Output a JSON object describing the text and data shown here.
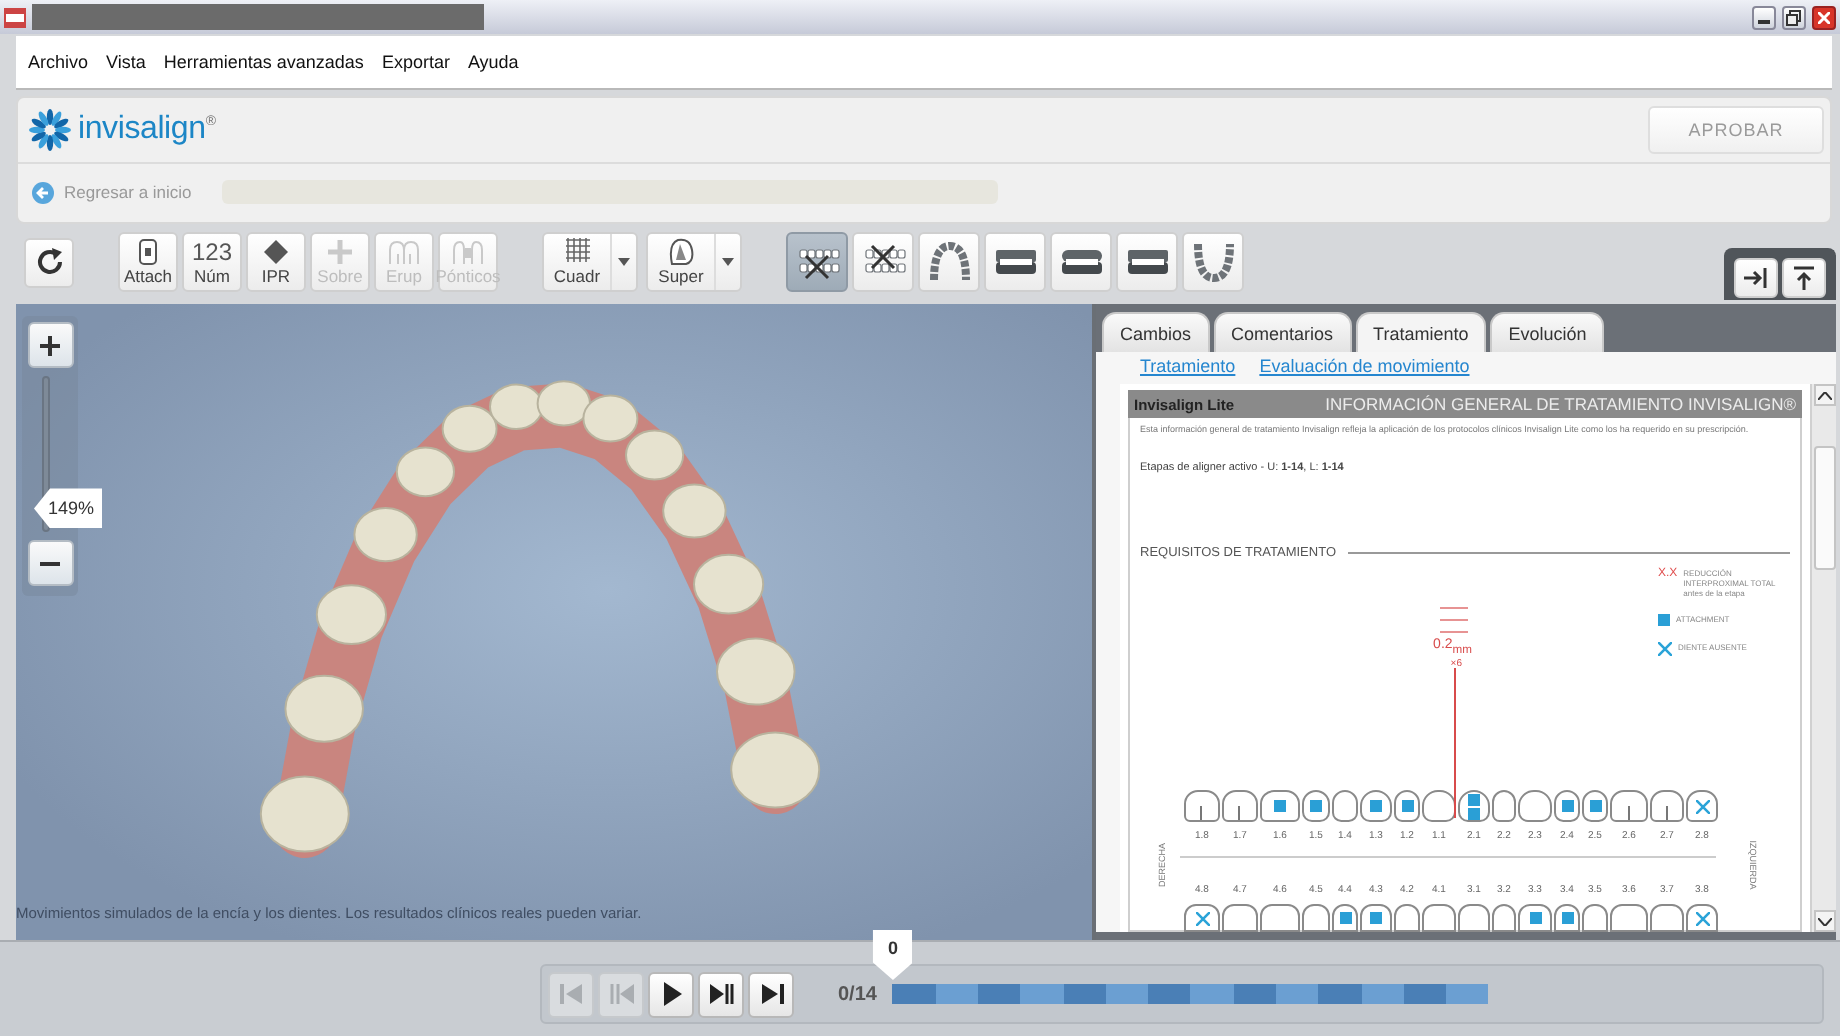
{
  "menu": [
    {
      "label": "Archivo"
    },
    {
      "label": "Vista"
    },
    {
      "label": "Herramientas avanzadas"
    },
    {
      "label": "Exportar"
    },
    {
      "label": "Ayuda"
    }
  ],
  "header": {
    "logo": "invisalign$^{®}$",
    "approve_button": "APROBAR",
    "back_link": "Regresar a inicio"
  },
  "toolbar": {
    "tools": [
      {
        "kind": "attach",
        "label": "Attach",
        "disabled": false
      },
      {
        "kind": "number",
        "glyph": "123",
        "label": "Núm",
        "disabled": false
      },
      {
        "kind": "ipr",
        "label": "IPR",
        "disabled": false
      },
      {
        "kind": "plus",
        "label": "Sobre",
        "disabled": true
      },
      {
        "kind": "erup",
        "label": "Erup",
        "disabled": true
      },
      {
        "kind": "pontic",
        "label": "Pónticos",
        "disabled": true
      }
    ],
    "dropdowns": [
      {
        "kind": "grid",
        "label": "Cuadr"
      },
      {
        "kind": "superimpose",
        "label": "Super"
      }
    ],
    "views": [
      {
        "kind": "hide-upper",
        "selected": true
      },
      {
        "kind": "hide-lower",
        "selected": false
      },
      {
        "kind": "upper-occlusal",
        "selected": false
      },
      {
        "kind": "right",
        "selected": false
      },
      {
        "kind": "front",
        "selected": false
      },
      {
        "kind": "left",
        "selected": false
      },
      {
        "kind": "lower-occlusal",
        "selected": false
      }
    ]
  },
  "viewer": {
    "zoom": {
      "reading": "149%",
      "level": 0.15
    },
    "caption": "Movimientos simulados de la encía y los dientes. Los resultados clínicos reales pueden variar."
  },
  "panel": {
    "tabs": [
      {
        "label": "Cambios",
        "selected": false
      },
      {
        "label": "Comentarios",
        "selected": false
      },
      {
        "label": "Tratamiento",
        "selected": true
      },
      {
        "label": "Evolución",
        "selected": false
      }
    ],
    "links": [
      {
        "label": "Tratamiento"
      },
      {
        "label": "Evaluación de movimiento"
      }
    ],
    "document": {
      "product": "Invisalign Lite",
      "heading": "INFORMACIÓN GENERAL DE TRATAMIENTO INVISALIGN®",
      "intro": "Esta información general de tratamiento Invisalign refleja la aplicación de los protocolos clínicos Invisalign Lite como los ha requerido en su prescripción.",
      "stages": "Etapas de aligner activo - U: **1-14**, L: **1-14**",
      "section": "REQUISITOS DE TRATAMIENTO",
      "legend": [
        {
          "kind": "ipr",
          "symbol": "X.X",
          "label": "REDUCCIÓN INTERPROXIMAL TOTAL antes de la etapa"
        },
        {
          "kind": "attachment",
          "label": "ATTACHMENT"
        },
        {
          "kind": "missing",
          "label": "DIENTE AUSENTE"
        }
      ],
      "ipr": {
        "amount": "0.2$_{mm}$",
        "stage": "×6"
      },
      "side_labels": [
        "DERECHA",
        "IZQUIERDA"
      ],
      "upper_teeth": [
        {
          "number": "1.8",
          "kind": "plain",
          "ipr": false
        },
        {
          "number": "1.7",
          "kind": "plain",
          "ipr": false
        },
        {
          "number": "1.6",
          "kind": "attachment",
          "ipr": false
        },
        {
          "number": "1.5",
          "kind": "attachment",
          "ipr": false
        },
        {
          "number": "1.4",
          "kind": "plain",
          "ipr": false
        },
        {
          "number": "1.3",
          "kind": "attachment",
          "ipr": false
        },
        {
          "number": "1.2",
          "kind": "attachment",
          "ipr": false
        },
        {
          "number": "1.1",
          "kind": "plain",
          "ipr": true
        },
        {
          "number": "2.1",
          "kind": "double-attachment",
          "ipr": false
        },
        {
          "number": "2.2",
          "kind": "plain",
          "ipr": false
        },
        {
          "number": "2.3",
          "kind": "plain",
          "ipr": false
        },
        {
          "number": "2.4",
          "kind": "attachment",
          "ipr": false
        },
        {
          "number": "2.5",
          "kind": "attachment",
          "ipr": false
        },
        {
          "number": "2.6",
          "kind": "plain",
          "ipr": false
        },
        {
          "number": "2.7",
          "kind": "plain",
          "ipr": false
        },
        {
          "number": "2.8",
          "kind": "missing",
          "ipr": false
        }
      ],
      "lower_teeth": [
        {
          "number": "4.8",
          "kind": "missing"
        },
        {
          "number": "4.7",
          "kind": "plain"
        },
        {
          "number": "4.6",
          "kind": "plain"
        },
        {
          "number": "4.5",
          "kind": "plain"
        },
        {
          "number": "4.4",
          "kind": "attachment"
        },
        {
          "number": "4.3",
          "kind": "attachment"
        },
        {
          "number": "4.2",
          "kind": "plain"
        },
        {
          "number": "4.1",
          "kind": "plain"
        },
        {
          "number": "3.1",
          "kind": "plain"
        },
        {
          "number": "3.2",
          "kind": "plain"
        },
        {
          "number": "3.3",
          "kind": "attachment"
        },
        {
          "number": "3.4",
          "kind": "attachment"
        },
        {
          "number": "3.5",
          "kind": "plain"
        },
        {
          "number": "3.6",
          "kind": "plain"
        },
        {
          "number": "3.7",
          "kind": "plain"
        },
        {
          "number": "3.8",
          "kind": "missing"
        }
      ]
    }
  },
  "playback": {
    "stage_bubble": "0",
    "stage_count": "0/14",
    "level": 0,
    "buttons": [
      {
        "kind": "first",
        "disabled": true
      },
      {
        "kind": "step-back",
        "disabled": true
      },
      {
        "kind": "play",
        "disabled": false
      },
      {
        "kind": "step-forward",
        "disabled": false
      },
      {
        "kind": "last",
        "disabled": false
      }
    ]
  }
}
